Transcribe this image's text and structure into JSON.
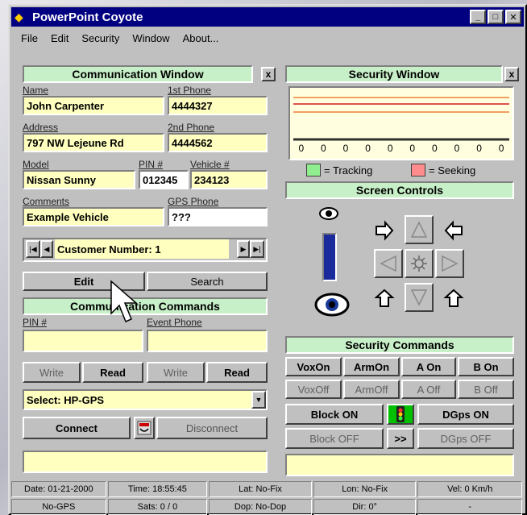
{
  "app": {
    "title": "PowerPoint Coyote"
  },
  "menu": [
    "File",
    "Edit",
    "Security",
    "Window",
    "About..."
  ],
  "comm": {
    "title": "Communication Window",
    "close": "x",
    "labels": {
      "name": "Name",
      "phone1": "1st Phone",
      "address": "Address",
      "phone2": "2nd Phone",
      "model": "Model",
      "pin": "PIN #",
      "vehicle": "Vehicle #",
      "comments": "Comments",
      "gps_phone": "GPS Phone"
    },
    "values": {
      "name": "John Carpenter",
      "phone1": "4444327",
      "address": "797 NW Lejeune Rd",
      "phone2": "4444562",
      "model": "Nissan Sunny",
      "pin": "012345",
      "vehicle": "234123",
      "comments": "Example Vehicle",
      "gps_phone": "???"
    },
    "nav": {
      "first": "|◀",
      "prev": "◀",
      "label": "Customer Number: 1",
      "next": "▶",
      "last": "▶|"
    },
    "edit": "Edit",
    "search": "Search",
    "commands_title": "Communication Commands",
    "cmd_labels": {
      "pin": "PIN #",
      "event_phone": "Event Phone"
    },
    "write1": "Write",
    "read1": "Read",
    "write2": "Write",
    "read2": "Read",
    "select_value": "Select: HP-GPS",
    "connect": "Connect",
    "disconnect": "Disconnect"
  },
  "security": {
    "title": "Security Window",
    "close": "x",
    "zeros": [
      "0",
      "0",
      "0",
      "0",
      "0",
      "0",
      "0",
      "0",
      "0",
      "0"
    ],
    "legend": {
      "tracking": "= Tracking",
      "seeking": "= Seeking",
      "tracking_color": "#90ee90",
      "seeking_color": "#ff8c8c"
    },
    "screen_controls": "Screen Controls",
    "commands_title": "Security Commands",
    "row1": [
      "VoxOn",
      "ArmOn",
      "A On",
      "B On"
    ],
    "row2": [
      "VoxOff",
      "ArmOff",
      "A Off",
      "B Off"
    ],
    "block_on": "Block ON",
    "dgps_on": "DGps ON",
    "block_off": "Block OFF",
    "more": ">>",
    "dgps_off": "DGps OFF"
  },
  "status1": [
    "Date: 01-21-2000",
    "Time: 18:55:45",
    "Lat: No-Fix",
    "Lon: No-Fix",
    "Vel: 0 Km/h"
  ],
  "status2": [
    "No-GPS",
    "Sats: 0 / 0",
    "Dop: No-Dop",
    "Dir: 0°",
    "-"
  ]
}
